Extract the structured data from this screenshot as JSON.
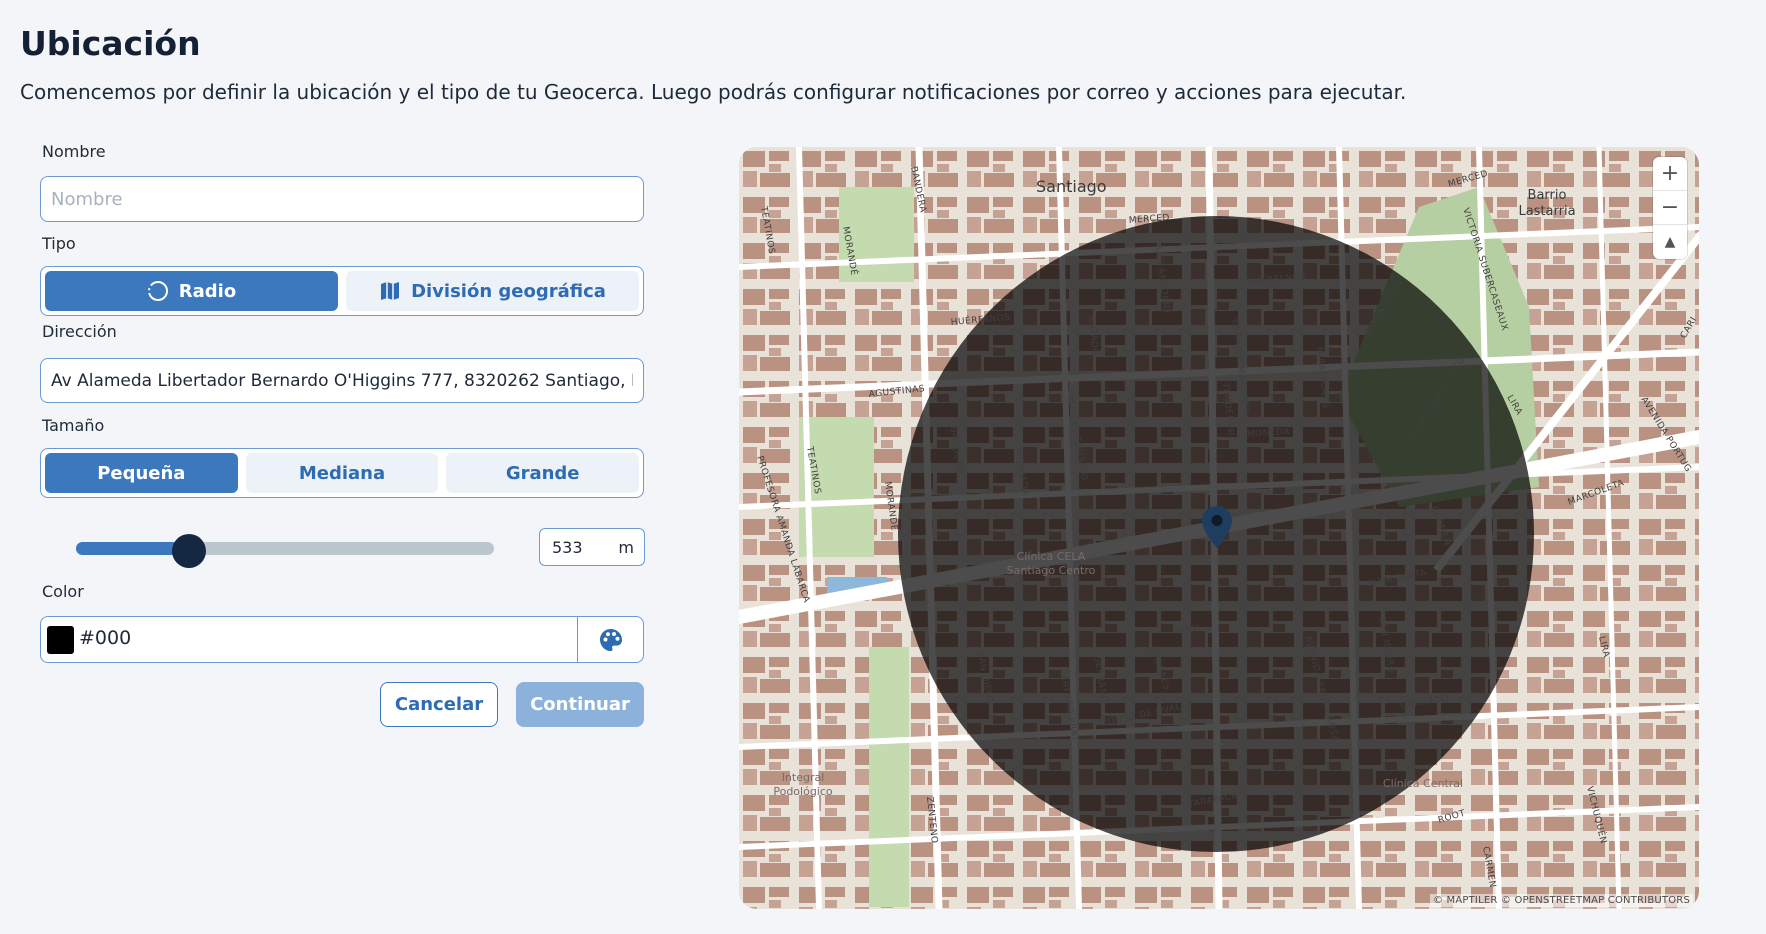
{
  "page": {
    "title": "Ubicación",
    "description": "Comencemos por definir la ubicación y el tipo de tu Geocerca. Luego podrás configurar notificaciones por correo y acciones para ejecutar."
  },
  "form": {
    "name": {
      "label": "Nombre",
      "value": "",
      "placeholder": "Nombre"
    },
    "type": {
      "label": "Tipo",
      "options": [
        {
          "label": "Radio",
          "icon": "circle-dashed-icon",
          "selected": true
        },
        {
          "label": "División geográfica",
          "icon": "map-folded-icon",
          "selected": false
        }
      ]
    },
    "address": {
      "label": "Dirección",
      "value": "Av Alameda Libertador Bernardo O'Higgins 777, 8320262 Santiago, Región Metropolitana, Chile"
    },
    "size": {
      "label": "Tamaño",
      "options": [
        {
          "label": "Pequeña",
          "selected": true
        },
        {
          "label": "Mediana",
          "selected": false
        },
        {
          "label": "Grande",
          "selected": false
        }
      ],
      "slider_fraction": 0.27,
      "value": "533",
      "unit": "m"
    },
    "color": {
      "label": "Color",
      "value": "#000",
      "swatch": "#000000"
    },
    "actions": {
      "cancel": "Cancelar",
      "continue": "Continuar"
    }
  },
  "map": {
    "labels": {
      "santiago": "Santiago",
      "barrio_lastarria": [
        "Barrio",
        "Lastarria"
      ],
      "clinica_cela": [
        "Clínica CELA",
        "Santiago Centro"
      ],
      "integral": [
        "Integral",
        "Podológico"
      ],
      "clinica_central": "Clínica Central"
    },
    "streets": {
      "bandera": "BANDERA",
      "teatinos": "TEATINOS",
      "morande": "MORANDÉ",
      "merced": "MERCED",
      "huerfanos": "HUÉRFANOS",
      "san_antonio": "SAN ANTONIO",
      "estado": "ESTADO",
      "enrique_mac_iver": "ENRIQUE MAC IVER",
      "miraflores": "MIRAFLORES",
      "santa_lucia": "SANTA LUCÍA",
      "cerro_santa_lucia": "CERRO SANTA LUCÍA",
      "victoria_subercaseaux": "VICTORIA SUBERCASEAUX",
      "agustinas": "AGUSTINAS",
      "matias_cousino": "MATÍAS COUSIÑO",
      "ahumada": "AHUMADA",
      "tenderini": "TENDERINI",
      "moneda": "MONEDA",
      "lira": "LIRA",
      "avenida_portugal": "AVENIDA PORTUG",
      "marcoleta": "MARCOLETA",
      "carmen": "CARMEN",
      "profesora_amanda_labarca": "PROFESORA AMANDA LABARCA",
      "paris": "PARÍS",
      "londres": "LONDRES",
      "san_diego": "SAN DIEGO",
      "arturo_prat": "ARTURO PRAT",
      "serrano": "SERRANO",
      "alonso_de_ovalle": "ALONSO DE OVALLE",
      "avenida_santa_rosa": "AVENIDA SANTA ROSA",
      "san_isidro": "SAN ISIDRO",
      "granado": "GRANADO",
      "tarapaca": "TARAPACÁ",
      "nataniel_cox": "NATANIEL COX",
      "zenteno": "ZENTENO",
      "root": "ROOT",
      "vichuquen": "VICHUQUÉN",
      "cari": "CARI"
    },
    "attribution": "© MAPTILER © OPENSTREETMAP CONTRIBUTORS",
    "controls": {
      "zoom_in": "+",
      "zoom_out": "−",
      "compass": "▲"
    },
    "geofence": {
      "fill": "#000000",
      "opacity": 0.7
    },
    "pin_color": "#1e3d5f"
  }
}
